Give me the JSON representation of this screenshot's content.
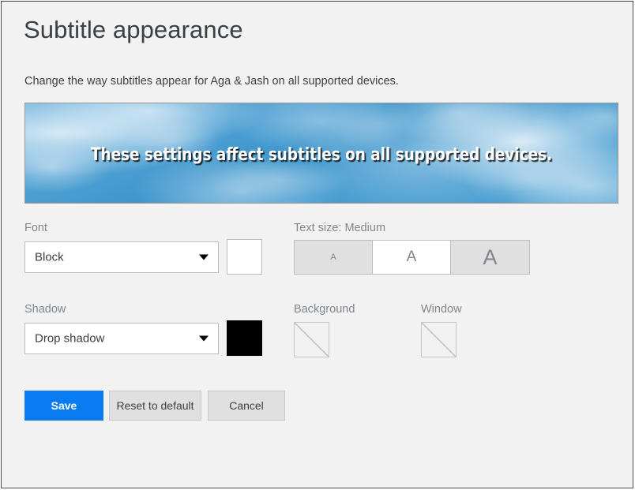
{
  "page": {
    "title": "Subtitle appearance",
    "description": "Change the way subtitles appear for Aga & Jash on all supported devices."
  },
  "preview": {
    "caption": "These settings affect subtitles on all supported devices.",
    "background_image": "cloudy-blue-sky",
    "text_color": "#ffffff",
    "shadow_color": "#141414"
  },
  "font_field": {
    "label": "Font",
    "value": "Block",
    "arrow_icon": "chevron-down-icon",
    "color_swatch": "#ffffff"
  },
  "text_size_field": {
    "label": "Text size: Medium",
    "selected": "Medium",
    "options": [
      {
        "name": "Small",
        "glyph": "A"
      },
      {
        "name": "Medium",
        "glyph": "A"
      },
      {
        "name": "Large",
        "glyph": "A"
      }
    ]
  },
  "shadow_field": {
    "label": "Shadow",
    "value": "Drop shadow",
    "arrow_icon": "chevron-down-icon",
    "color_swatch": "#000000"
  },
  "background_field": {
    "label": "Background",
    "swatch_state": "none"
  },
  "window_field": {
    "label": "Window",
    "swatch_state": "none"
  },
  "actions": {
    "save": "Save",
    "reset": "Reset to default",
    "cancel": "Cancel",
    "save_color": "#0b7bf1"
  }
}
